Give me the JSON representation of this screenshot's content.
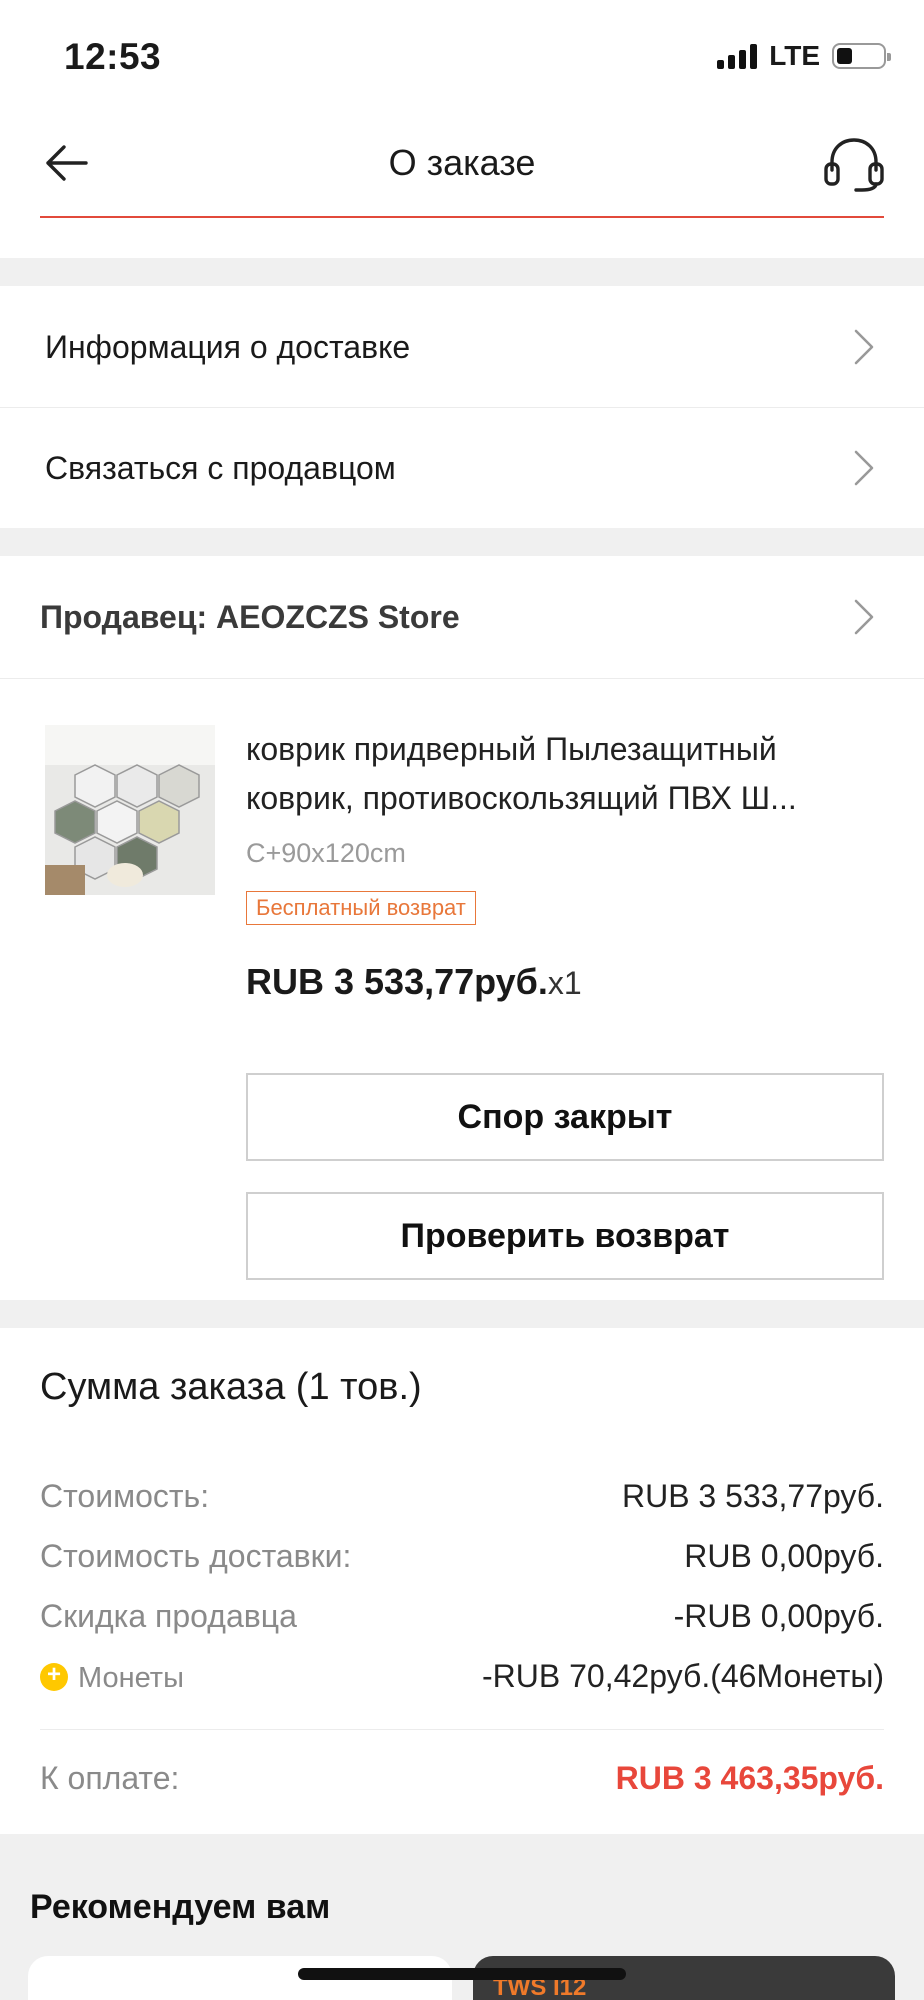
{
  "status_bar": {
    "time": "12:53",
    "network": "LTE",
    "battery_level": 0.34
  },
  "header": {
    "title": "О заказе",
    "back_icon": "arrow-left-icon",
    "support_icon": "headset-icon",
    "accent_color": "#e24a3b"
  },
  "menu": {
    "delivery_info": "Информация о доставке",
    "contact_seller": "Связаться с продавцом"
  },
  "seller": {
    "label": "Продавец: AEOZCZS Store"
  },
  "product": {
    "title": "коврик придверный Пылезащитный коврик, противоскользящий ПВХ Ш...",
    "sku": "C+90x120cm",
    "badge": "Бесплатный возврат",
    "price": "RUB 3 533,77руб.",
    "quantity": "x1",
    "buttons": {
      "dispute": "Спор закрыт",
      "check_return": "Проверить возврат"
    }
  },
  "summary": {
    "title": "Сумма заказа (1 тов.)",
    "rows": [
      {
        "label": "Стоимость:",
        "value": "RUB 3 533,77руб."
      },
      {
        "label": "Стоимость доставки:",
        "value": "RUB 0,00руб."
      },
      {
        "label": "Скидка продавца",
        "value": "-RUB 0,00руб."
      },
      {
        "label": "Монеты",
        "value": "-RUB 70,42руб.(46Монеты)"
      }
    ],
    "total_label": "К оплате:",
    "total_value": "RUB 3 463,35руб.",
    "total_color": "#e8473b"
  },
  "recommend": {
    "title": "Рекомендуем вам",
    "card_promo": "TWS  I12"
  }
}
